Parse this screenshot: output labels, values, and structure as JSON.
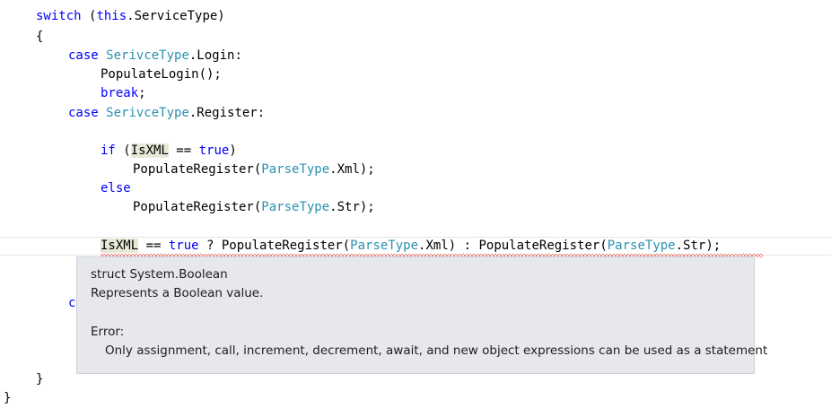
{
  "code": {
    "l1": {
      "kw": "switch",
      "paren": " (",
      "this": "this",
      "rest": ".ServiceType)"
    },
    "l2": "{",
    "l3": {
      "kw": "case",
      "type": "SerivceType",
      "rest": ".Login:"
    },
    "l4": "PopulateLogin();",
    "l5": {
      "kw": "break",
      "rest": ";"
    },
    "l6": {
      "kw": "case",
      "type": "SerivceType",
      "rest": ".Register:"
    },
    "l7": {
      "kw": "if",
      "p1": " (",
      "var": "IsXML",
      "op": " == ",
      "val": "true",
      "p2": ")"
    },
    "l8": {
      "call": "PopulateRegister(",
      "type": "ParseType",
      "rest": ".Xml);"
    },
    "l9": {
      "kw": "else"
    },
    "l10": {
      "call": "PopulateRegister(",
      "type": "ParseType",
      "rest": ".Str);"
    },
    "l11": {
      "var": "IsXML",
      "op": " == ",
      "val": "true",
      "mid1": " ? PopulateRegister(",
      "type1": "ParseType",
      "mid2": ".Xml) : PopulateRegister(",
      "type2": "ParseType",
      "end": ".Str);"
    },
    "l12_partial": "c",
    "l13": "}",
    "l14": "}"
  },
  "tooltip": {
    "signature": "struct System.Boolean",
    "summary": "Represents a Boolean value.",
    "error_label": "Error:",
    "error_message": "Only assignment, call, increment, decrement, await, and new object expressions can be used as a statement"
  },
  "colors": {
    "keyword": "#0000ff",
    "type": "#2b91af",
    "error_squiggle": "#e51400",
    "tooltip_bg": "#e7e8ec"
  }
}
